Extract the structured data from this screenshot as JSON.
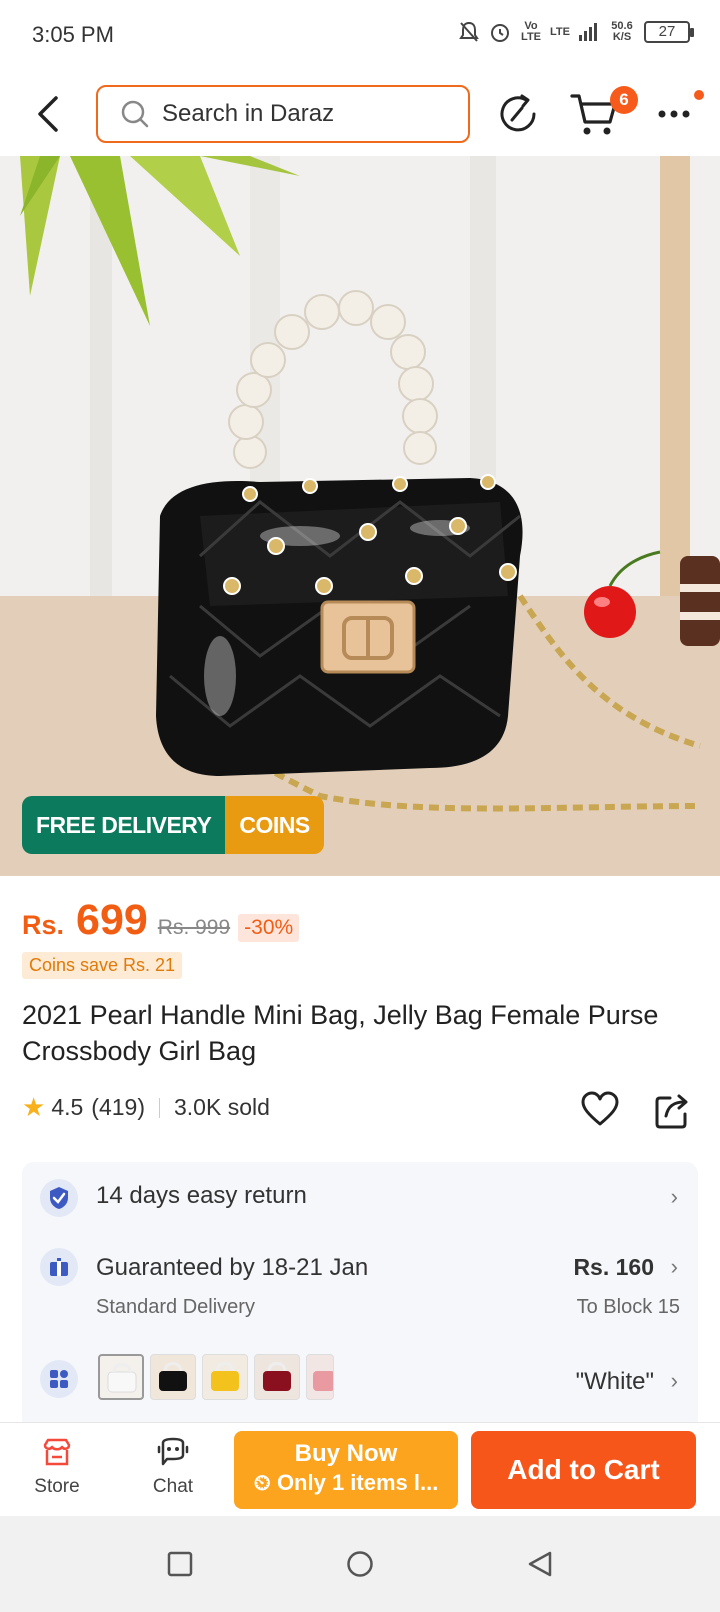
{
  "status_bar": {
    "time": "3:05 PM",
    "network_type": "LTE",
    "volte_label": "Vo LTE",
    "speed": "50.6",
    "speed_unit": "K/S",
    "battery": "27"
  },
  "header": {
    "search_placeholder": "Search in Daraz",
    "cart_count": "6"
  },
  "product_image": {
    "badges": {
      "free_delivery": "FREE DELIVERY",
      "coins": "COINS"
    }
  },
  "price": {
    "currency": "Rs.",
    "current": "699",
    "original": "Rs. 999",
    "discount": "-30%",
    "coins_save": "Coins save Rs. 21"
  },
  "product": {
    "title": "2021 Pearl Handle Mini Bag, Jelly Bag Female Purse Crossbody Girl Bag",
    "rating": "4.5",
    "reviews": "(419)",
    "sold": "3.0K sold"
  },
  "info": {
    "returns": "14 days easy return",
    "delivery_main": "Guaranteed by 18-21 Jan",
    "delivery_sub": "Standard Delivery",
    "delivery_price": "Rs. 160",
    "delivery_location": "To Block 15",
    "variant_selected": "\"White\""
  },
  "bottom_bar": {
    "store_label": "Store",
    "chat_label": "Chat",
    "buy_now_label": "Buy Now",
    "buy_now_sub": "Only 1 items l...",
    "add_to_cart_label": "Add to Cart"
  },
  "colors": {
    "accent": "#f7561b",
    "buy_now": "#fca41d",
    "free_delivery": "#0c7a5c",
    "coins": "#e89a10"
  }
}
